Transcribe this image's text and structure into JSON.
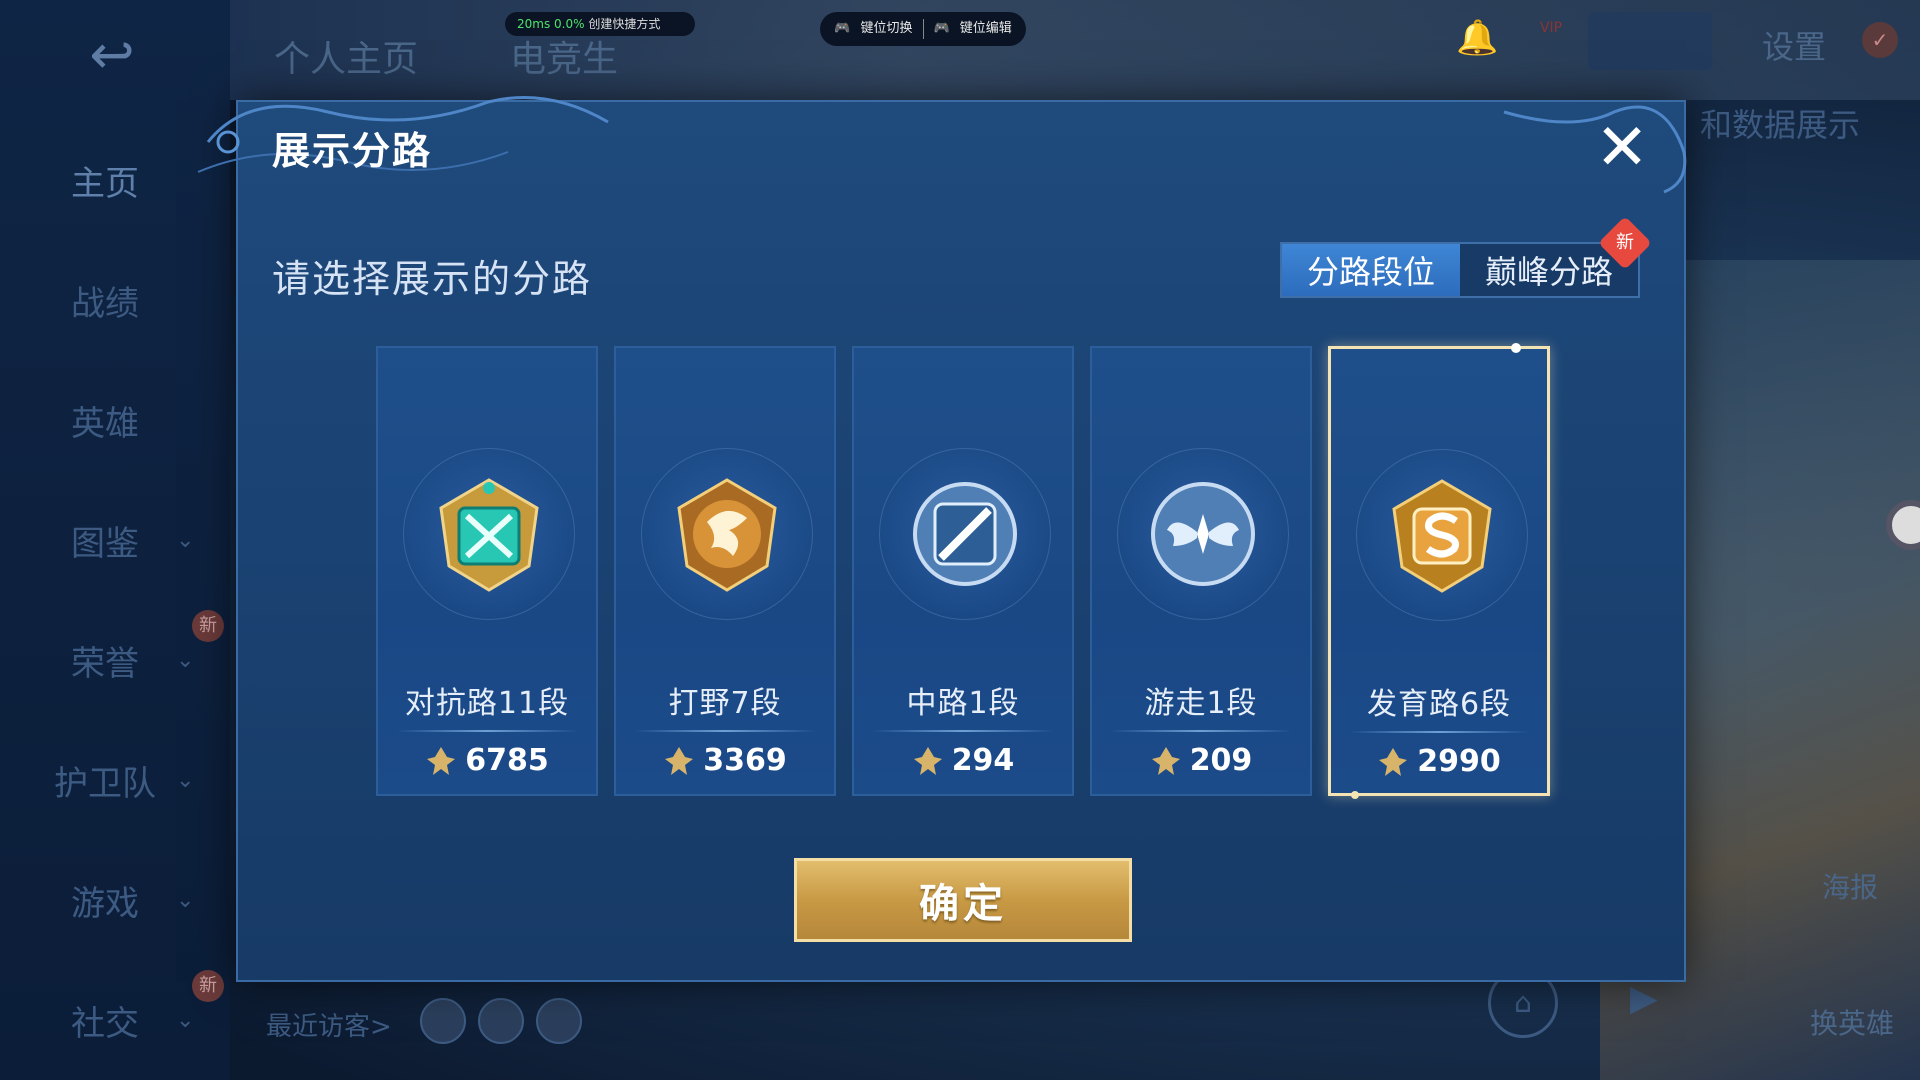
{
  "status": {
    "latency": "20ms",
    "loss": "0.0%",
    "shortcut": "创建快捷方式"
  },
  "keybar": {
    "switch": "键位切换",
    "edit": "键位编辑"
  },
  "top_tabs": [
    "个人主页",
    "电竞生"
  ],
  "topbar": {
    "settings": "设置",
    "vip": "VIP",
    "data_show": "和数据展示"
  },
  "sidebar": {
    "items": [
      {
        "label": "主页"
      },
      {
        "label": "战绩"
      },
      {
        "label": "英雄"
      },
      {
        "label": "图鉴"
      },
      {
        "label": "荣誉"
      },
      {
        "label": "护卫队"
      },
      {
        "label": "游戏"
      },
      {
        "label": "社交"
      }
    ],
    "new_badge": "新"
  },
  "bottom": {
    "recent_visitors": "最近访客>",
    "poster": "海报",
    "swap_hero": "换英雄"
  },
  "modal": {
    "title": "展示分路",
    "subtitle": "请选择展示的分路",
    "tabs": [
      {
        "label": "分路段位",
        "active": true
      },
      {
        "label": "巅峰分路",
        "active": false
      }
    ],
    "tab_new_badge": "新",
    "cards": [
      {
        "role": "对抗路11段",
        "points": "6785",
        "emblem": "crossed-swords-emblem",
        "color": "#2fc4b5",
        "selected": false
      },
      {
        "role": "打野7段",
        "points": "3369",
        "emblem": "dragon-emblem",
        "color": "#d99a3e",
        "selected": false
      },
      {
        "role": "中路1段",
        "points": "294",
        "emblem": "mid-lane-emblem",
        "color": "#6fa7dc",
        "selected": false
      },
      {
        "role": "游走1段",
        "points": "209",
        "emblem": "wings-emblem",
        "color": "#6fa7dc",
        "selected": false
      },
      {
        "role": "发育路6段",
        "points": "2990",
        "emblem": "marksman-emblem",
        "color": "#e6a240",
        "selected": true
      }
    ],
    "confirm": "确定"
  }
}
